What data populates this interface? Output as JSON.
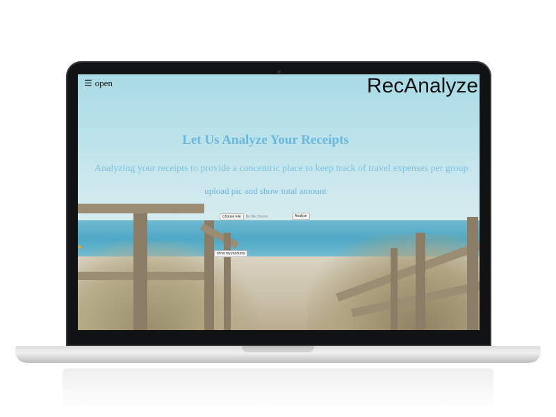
{
  "nav": {
    "menu_label": "open",
    "brand": "RecAnalyze"
  },
  "hero": {
    "title": "Let Us Analyze Your Receipts",
    "subtitle": "Analyzing your receipts to provide a concentric place to keep track of travel expenses per group",
    "action": "upload pic and show total amount"
  },
  "upload": {
    "choose_file": "Choose File",
    "file_status": "No file chosen",
    "analyze": "Analyze",
    "show_products": "show my products"
  },
  "colors": {
    "title": "#6ab7e0",
    "subtitle": "#7ec3e4"
  }
}
